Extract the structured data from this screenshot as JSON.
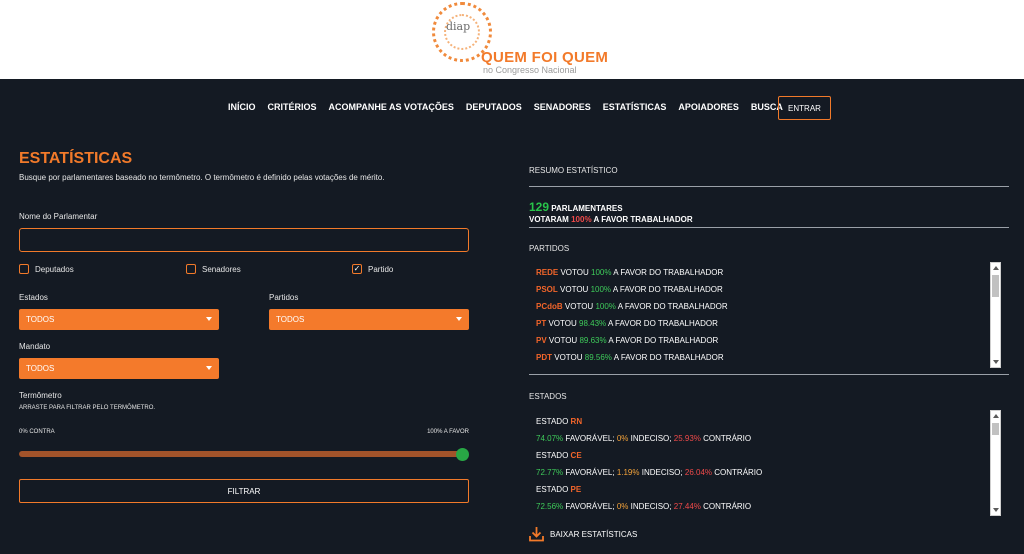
{
  "brand": {
    "mark": "diap",
    "title": "QUEM FOI QUEM",
    "subtitle": "no Congresso Nacional"
  },
  "nav": {
    "items": [
      "INÍCIO",
      "CRITÉRIOS",
      "ACOMPANHE AS VOTAÇÕES",
      "DEPUTADOS",
      "SENADORES",
      "ESTATÍSTICAS",
      "APOIADORES",
      "BUSCA"
    ],
    "login": "ENTRAR"
  },
  "filters": {
    "title": "ESTATÍSTICAS",
    "subtitle": "Busque por parlamentares baseado no termômetro. O termômetro é definido pelas votações de mérito.",
    "name_label": "Nome do Parlamentar",
    "name_value": "",
    "checks": [
      {
        "label": "Deputados",
        "checked": false
      },
      {
        "label": "Senadores",
        "checked": false
      },
      {
        "label": "Partido",
        "checked": true
      }
    ],
    "estados_label": "Estados",
    "estados_value": "TODOS",
    "partidos_label": "Partidos",
    "partidos_value": "TODOS",
    "mandato_label": "Mandato",
    "mandato_value": "TODOS",
    "termometro_label": "Termômetro",
    "termometro_hint": "ARRASTE PARA FILTRAR PELO TERMÔMETRO.",
    "min_label": "0% CONTRA",
    "max_label": "100% A FAVOR",
    "slider_value": 1.0,
    "button": "FILTRAR"
  },
  "summary": {
    "title": "RESUMO ESTATÍSTICO",
    "count": "129",
    "count_label": "PARLAMENTARES",
    "voted_prefix": "VOTARAM",
    "voted_pct": "100%",
    "voted_suffix": "A FAVOR TRABALHADOR",
    "partidos_title": "PARTIDOS",
    "parties": [
      {
        "name": "REDE",
        "a": "VOTOU",
        "pct": "100%",
        "b": "A FAVOR DO TRABALHADOR"
      },
      {
        "name": "PSOL",
        "a": "VOTOU",
        "pct": "100%",
        "b": "A FAVOR DO TRABALHADOR"
      },
      {
        "name": "PCdoB",
        "a": "VOTOU",
        "pct": "100%",
        "b": "A FAVOR DO TRABALHADOR"
      },
      {
        "name": "PT",
        "a": "VOTOU",
        "pct": "98.43%",
        "b": "A FAVOR DO TRABALHADOR"
      },
      {
        "name": "PV",
        "a": "VOTOU",
        "pct": "89.63%",
        "b": "A FAVOR DO TRABALHADOR"
      },
      {
        "name": "PDT",
        "a": "VOTOU",
        "pct": "89.56%",
        "b": "A FAVOR DO TRABALHADOR"
      }
    ],
    "estados_title": "ESTADOS",
    "states": [
      {
        "prefix": "ESTADO",
        "uf": "RN",
        "fav": "74.07%",
        "fav_l": "FAVORÁVEL;",
        "ind": "0%",
        "ind_l": "INDECISO;",
        "con": "25.93%",
        "con_l": "CONTRÁRIO"
      },
      {
        "prefix": "ESTADO",
        "uf": "CE",
        "fav": "72.77%",
        "fav_l": "FAVORÁVEL;",
        "ind": "1.19%",
        "ind_l": "INDECISO;",
        "con": "26.04%",
        "con_l": "CONTRÁRIO"
      },
      {
        "prefix": "ESTADO",
        "uf": "PE",
        "fav": "72.56%",
        "fav_l": "FAVORÁVEL;",
        "ind": "0%",
        "ind_l": "INDECISO;",
        "con": "27.44%",
        "con_l": "CONTRÁRIO"
      }
    ],
    "download": "BAIXAR ESTATÍSTICAS"
  }
}
